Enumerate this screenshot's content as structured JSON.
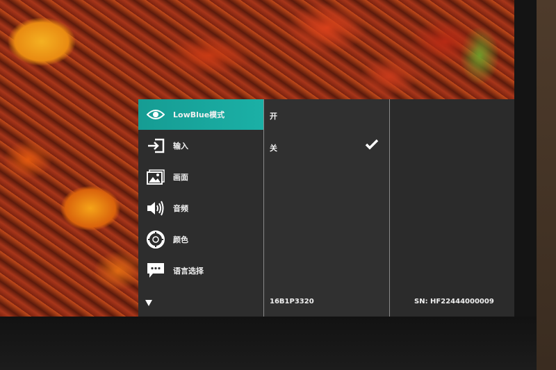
{
  "menu": {
    "items": [
      {
        "label": "LowBlue模式",
        "icon": "eye-icon",
        "active": true
      },
      {
        "label": "输入",
        "icon": "input-icon"
      },
      {
        "label": "画面",
        "icon": "picture-icon"
      },
      {
        "label": "音频",
        "icon": "speaker-icon"
      },
      {
        "label": "颜色",
        "icon": "color-icon"
      },
      {
        "label": "语言选择",
        "icon": "language-icon"
      }
    ],
    "more_icon": "triangle-down-icon"
  },
  "submenu": {
    "options": [
      {
        "label": "开",
        "selected": false
      },
      {
        "label": "关",
        "selected": true
      }
    ],
    "selected_icon": "checkmark-icon"
  },
  "footer": {
    "model": "16B1P3320",
    "serial": "SN: HF22444000009"
  },
  "colors": {
    "accent": "#1bb0a6",
    "panel": "#313131"
  }
}
